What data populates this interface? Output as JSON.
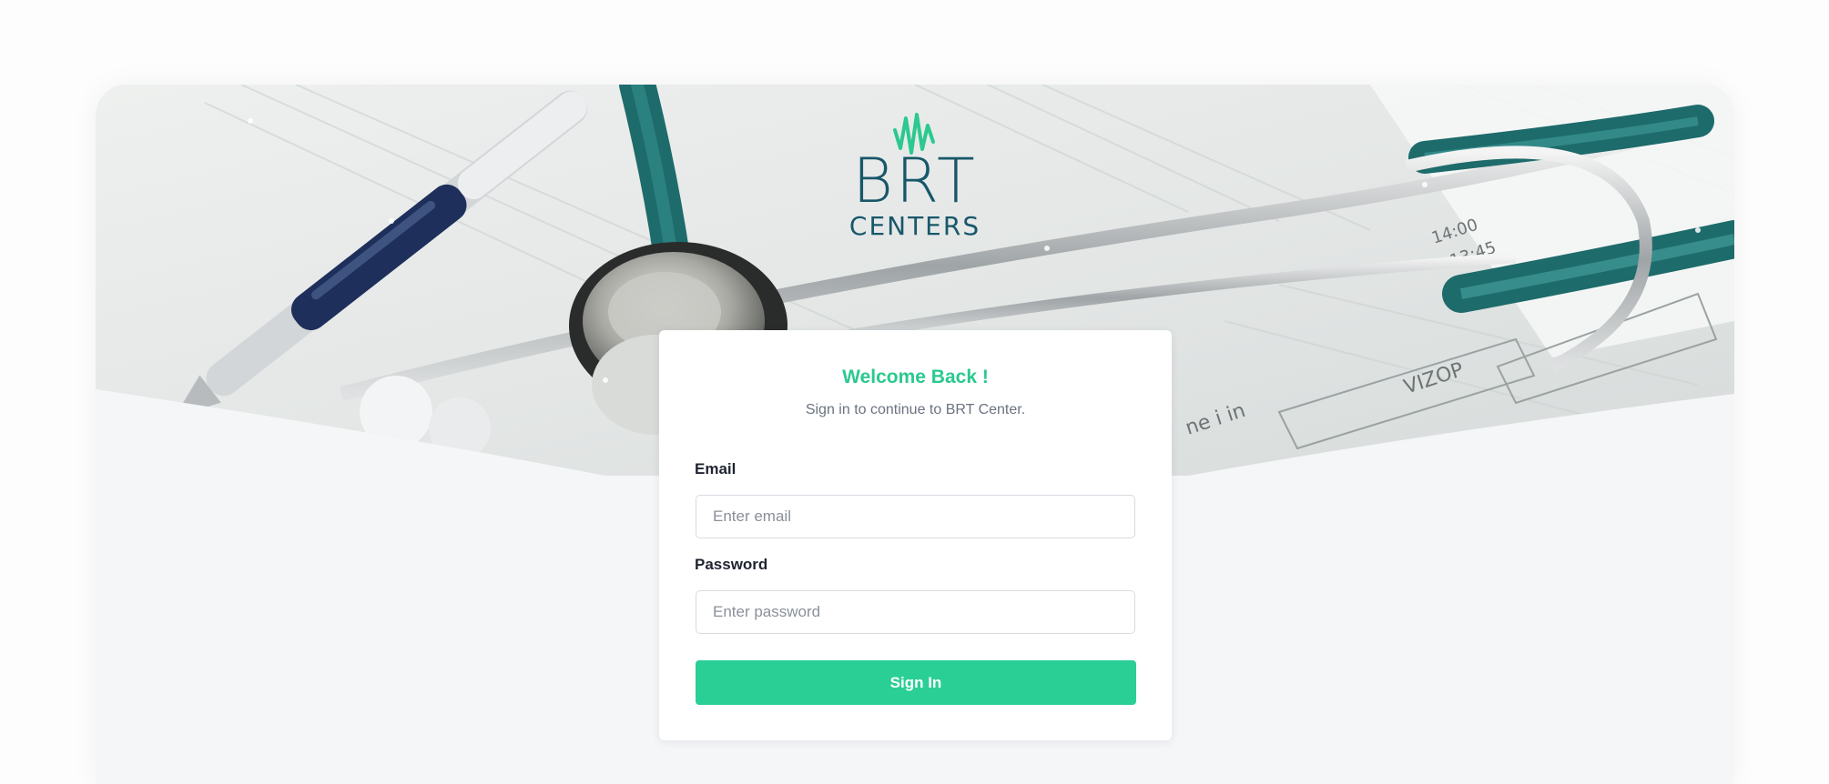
{
  "brand": {
    "logo_main": "BRT",
    "logo_sub": "CENTERS",
    "accent_color": "#2bc98f",
    "logo_color": "#17576a"
  },
  "hero": {
    "image_icon": "stethoscope-medical-image"
  },
  "login": {
    "title": "Welcome Back !",
    "subtitle": "Sign in to continue to BRT Center.",
    "email_label": "Email",
    "email_placeholder": "Enter email",
    "email_value": "",
    "password_label": "Password",
    "password_placeholder": "Enter password",
    "password_value": "",
    "submit_label": "Sign In"
  }
}
